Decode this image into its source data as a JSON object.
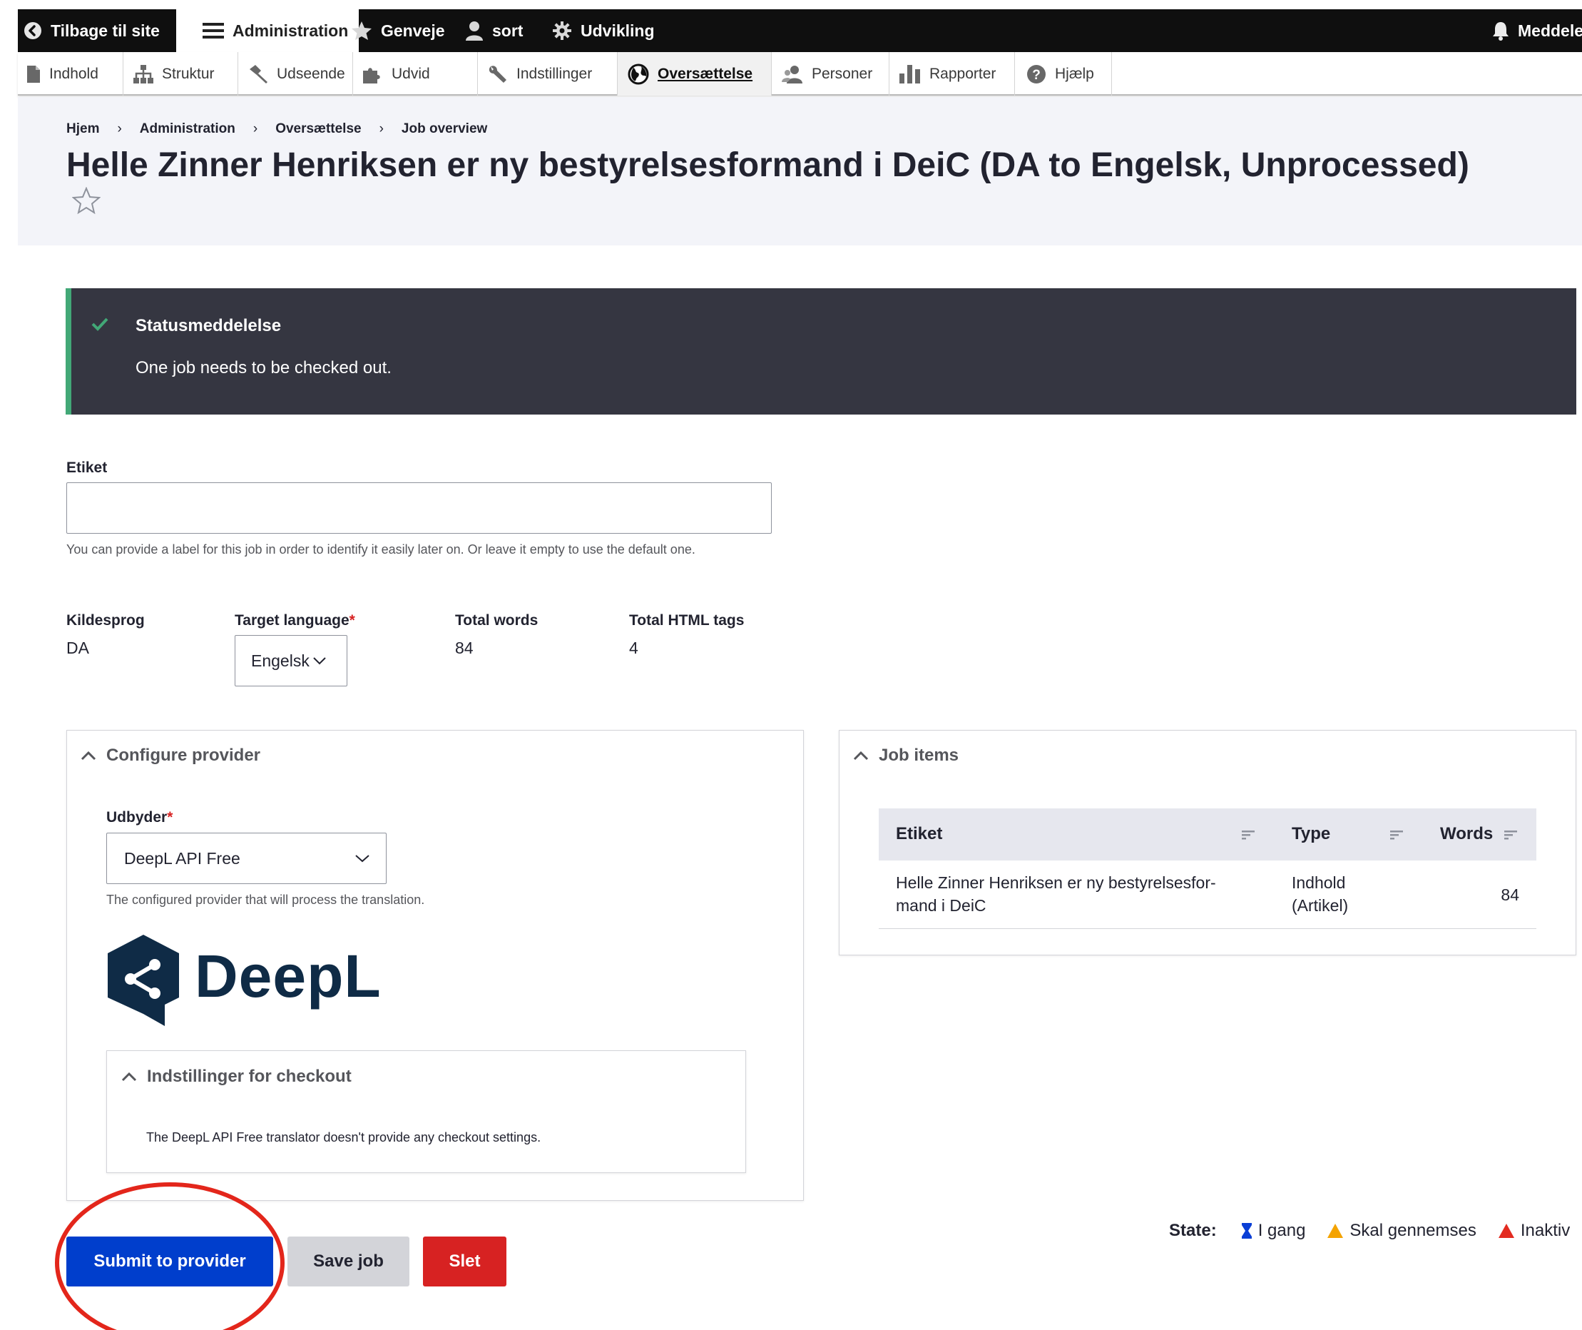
{
  "toolbar": {
    "back": "Tilbage til site",
    "admin": "Administration",
    "shortcuts": "Genveje",
    "user": "sort",
    "devel": "Udvikling",
    "notifications": "Meddele"
  },
  "tray": [
    "Indhold",
    "Struktur",
    "Udseende",
    "Udvid",
    "Indstillinger",
    "Oversættelse",
    "Personer",
    "Rapporter",
    "Hjælp"
  ],
  "breadcrumb": [
    "Hjem",
    "Administration",
    "Oversættelse",
    "Job overview"
  ],
  "page_title": "Helle Zinner Henriksen er ny bestyrelsesformand i DeiC (DA to Engelsk, Unprocessed)",
  "status": {
    "title": "Statusmeddelelse",
    "message": "One job needs to be checked out."
  },
  "label_field": {
    "label": "Etiket",
    "value": "",
    "description": "You can provide a label for this job in order to identify it easily later on. Or leave it empty to use the default one."
  },
  "info": {
    "source_label": "Kildesprog",
    "source_value": "DA",
    "target_label": "Target language",
    "target_value": "Engelsk",
    "words_label": "Total words",
    "words_value": "84",
    "tags_label": "Total HTML tags",
    "tags_value": "4"
  },
  "provider": {
    "panel_title": "Configure provider",
    "field_label": "Udbyder",
    "selected": "DeepL API Free",
    "description": "The configured provider that will process the translation.",
    "logo_text": "DeepL",
    "checkout_title": "Indstillinger for checkout",
    "checkout_text": "The DeepL API Free translator doesn't provide any checkout settings."
  },
  "job_items": {
    "panel_title": "Job items",
    "columns": [
      "Etiket",
      "Type",
      "Words"
    ],
    "rows": [
      {
        "label_line1": "Helle Zinner Henriksen er ny bestyrelsesfor-",
        "label_line2": "mand i DeiC",
        "type_line1": "Indhold",
        "type_line2": "(Artikel)",
        "words": "84"
      }
    ]
  },
  "legend": {
    "label": "State:",
    "items": [
      "I gang",
      "Skal gennemses",
      "Inaktiv"
    ]
  },
  "actions": {
    "submit": "Submit to provider",
    "save": "Save job",
    "delete": "Slet"
  },
  "colors": {
    "primary": "#003ecc",
    "danger": "#d72222",
    "status_accent": "#42a877",
    "logo": "#0f2b46",
    "annotation": "#e3261b"
  }
}
